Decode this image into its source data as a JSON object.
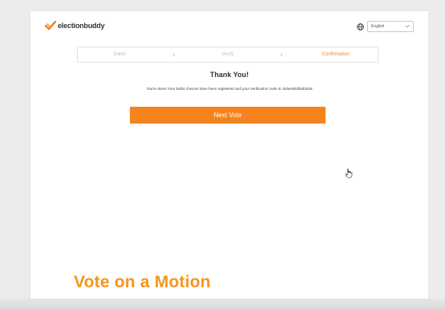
{
  "header": {
    "brand": "electionbuddy",
    "language": "English"
  },
  "steps": [
    {
      "label": "Ballot",
      "state": "done"
    },
    {
      "label": "Verify",
      "state": "done"
    },
    {
      "label": "Confirmation",
      "state": "active"
    }
  ],
  "step_separator": "›",
  "main": {
    "title": "Thank You!",
    "message": "You're done! Your ballot choices have been registered and your verification code is cbdee5bd55d3a36",
    "next_button": "Next Vote"
  },
  "caption": "Vote on a Motion",
  "colors": {
    "accent": "#f5841f",
    "caption": "#f5961f",
    "inactive_step": "#c4c4c4"
  },
  "icons": {
    "brand": "checkmark-logo-icon",
    "language": "globe-icon",
    "dropdown": "chevron-down-icon",
    "pointer": "hand-cursor-icon"
  }
}
